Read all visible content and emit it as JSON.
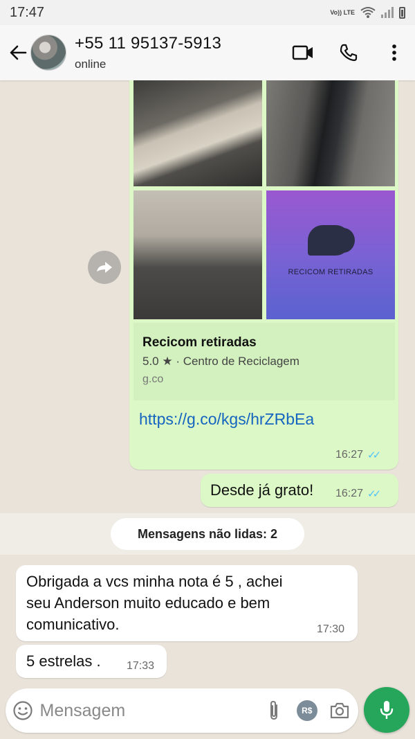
{
  "status_bar": {
    "time": "17:47",
    "network_label": "Vo)) LTE"
  },
  "header": {
    "contact_name": "+55 11 95137-5913",
    "contact_status": "online",
    "icons": [
      "back-arrow-icon",
      "video-call-icon",
      "phone-icon",
      "more-options-icon"
    ]
  },
  "messages": {
    "link_preview": {
      "image_logo_text": "RECICOM RETIRADAS",
      "title": "Recicom retiradas",
      "subtitle": "5.0 ★ · Centro de Reciclagem",
      "domain": "g.co",
      "url": "https://g.co/kgs/hrZRbEa",
      "time": "16:27",
      "ticks": "✓✓"
    },
    "outgoing_2": {
      "text": "Desde já grato!",
      "time": "16:27",
      "ticks": "✓✓"
    },
    "unread_divider": "Mensagens não lidas: 2",
    "incoming_1": {
      "lines": [
        "Obrigada a vcs minha nota é 5 , achei",
        "seu Anderson muito educado e bem",
        "comunicativo."
      ],
      "time": "17:30"
    },
    "incoming_2": {
      "text": "5 estrelas .",
      "time": "17:33"
    }
  },
  "composer": {
    "placeholder": "Mensagem",
    "payment_label": "R$"
  },
  "colors": {
    "outgoing_bubble": "#dcf8c6",
    "incoming_bubble": "#ffffff",
    "chat_background": "#e9e3da",
    "read_ticks": "#4fc3f7",
    "mic_button": "#26a65b",
    "link": "#1565c0"
  }
}
